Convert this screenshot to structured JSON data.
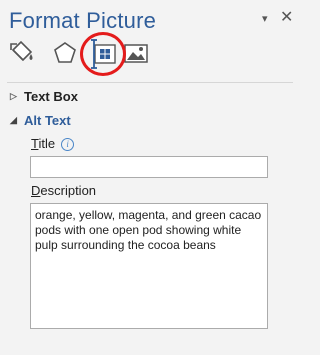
{
  "pane": {
    "title": "Format Picture",
    "menu_glyph": "▾",
    "close_glyph": "✕"
  },
  "tabs": [
    {
      "name": "fill-line-icon"
    },
    {
      "name": "effects-icon"
    },
    {
      "name": "size-properties-icon",
      "selected": true
    },
    {
      "name": "picture-icon"
    }
  ],
  "sections": {
    "text_box": {
      "label": "Text Box",
      "expanded": false
    },
    "alt_text": {
      "label": "Alt Text",
      "expanded": true
    }
  },
  "alt_text": {
    "title_label_access": "T",
    "title_label_rest": "itle",
    "title_value": "",
    "description_label_access": "D",
    "description_label_rest": "escription",
    "description_value": "orange, yellow, magenta, and green cacao pods with one open pod showing white pulp surrounding the cocoa beans"
  },
  "colors": {
    "accent": "#2f5d9a",
    "highlight_circle": "#e41b1b"
  }
}
